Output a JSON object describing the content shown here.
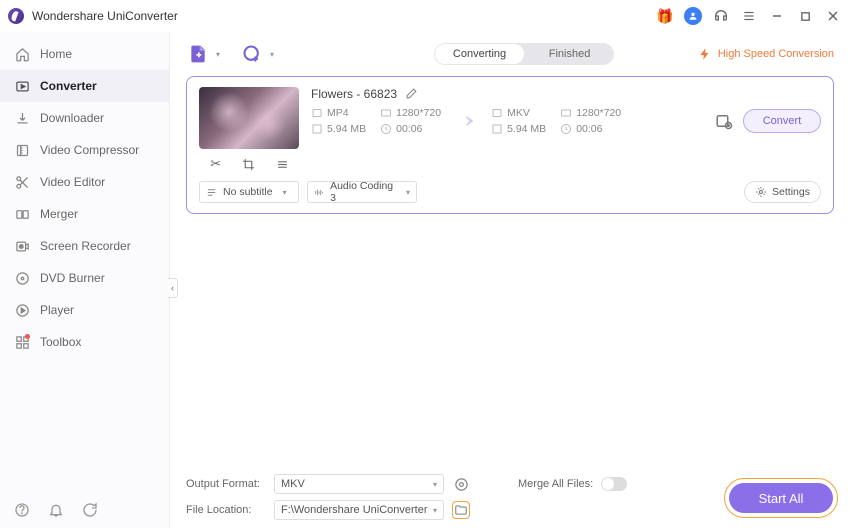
{
  "app": {
    "title": "Wondershare UniConverter"
  },
  "titlebar": {
    "gift": "🎁"
  },
  "sidebar": {
    "items": [
      {
        "label": "Home"
      },
      {
        "label": "Converter"
      },
      {
        "label": "Downloader"
      },
      {
        "label": "Video Compressor"
      },
      {
        "label": "Video Editor"
      },
      {
        "label": "Merger"
      },
      {
        "label": "Screen Recorder"
      },
      {
        "label": "DVD Burner"
      },
      {
        "label": "Player"
      },
      {
        "label": "Toolbox"
      }
    ]
  },
  "tabs": {
    "converting": "Converting",
    "finished": "Finished"
  },
  "hsc": "High Speed Conversion",
  "item": {
    "name": "Flowers - 66823",
    "src": {
      "fmt": "MP4",
      "res": "1280*720",
      "size": "5.94 MB",
      "dur": "00:06"
    },
    "dst": {
      "fmt": "MKV",
      "res": "1280*720",
      "size": "5.94 MB",
      "dur": "00:06"
    },
    "convert": "Convert",
    "subtitle": "No subtitle",
    "audio": "Audio Coding 3",
    "settings": "Settings"
  },
  "footer": {
    "outfmt_label": "Output Format:",
    "outfmt_value": "MKV",
    "loc_label": "File Location:",
    "loc_value": "F:\\Wondershare UniConverter",
    "merge_label": "Merge All Files:",
    "start_all": "Start All"
  }
}
